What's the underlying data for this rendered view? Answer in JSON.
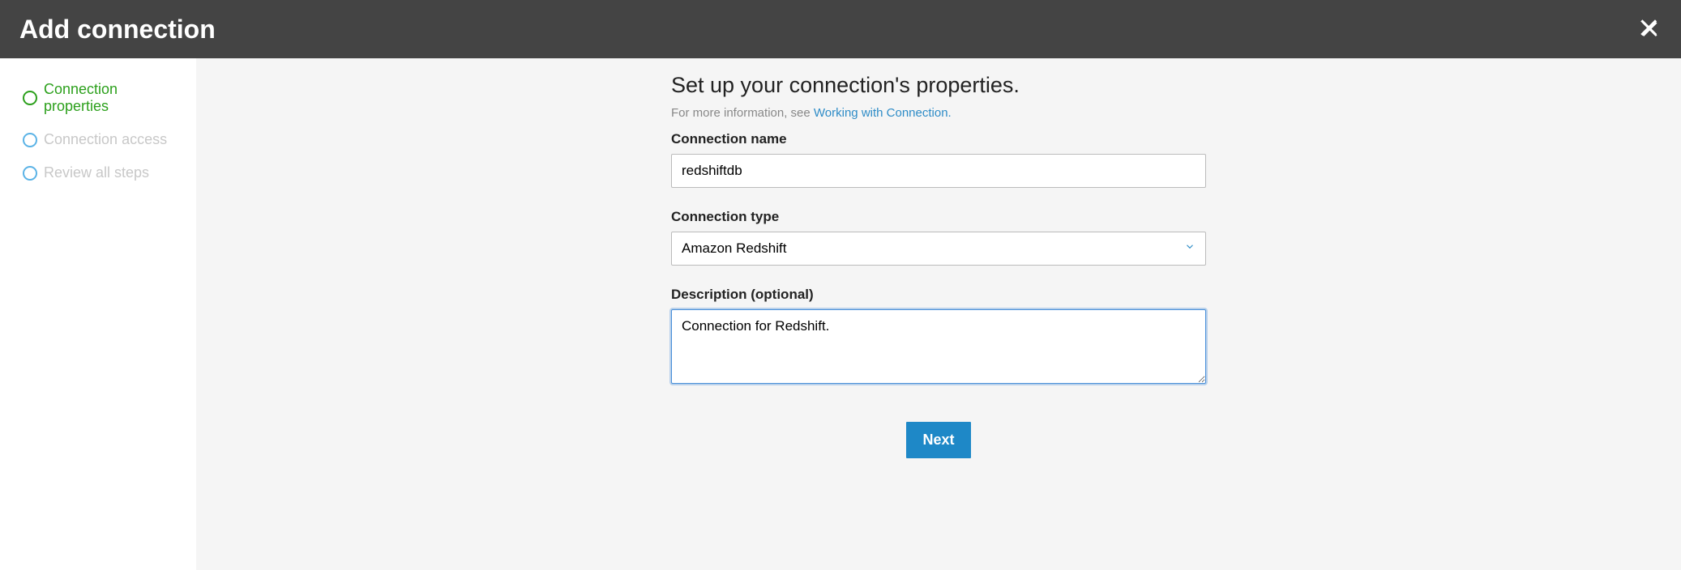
{
  "header": {
    "title": "Add connection"
  },
  "sidebar": {
    "steps": [
      {
        "label": "Connection properties"
      },
      {
        "label": "Connection access"
      },
      {
        "label": "Review all steps"
      }
    ]
  },
  "main": {
    "title": "Set up your connection's properties.",
    "info_prefix": "For more information, see ",
    "info_link": "Working with Connection.",
    "fields": {
      "name_label": "Connection name",
      "name_value": "redshiftdb",
      "type_label": "Connection type",
      "type_value": "Amazon Redshift",
      "desc_label": "Description (optional)",
      "desc_value": "Connection for Redshift."
    },
    "next_button": "Next"
  }
}
